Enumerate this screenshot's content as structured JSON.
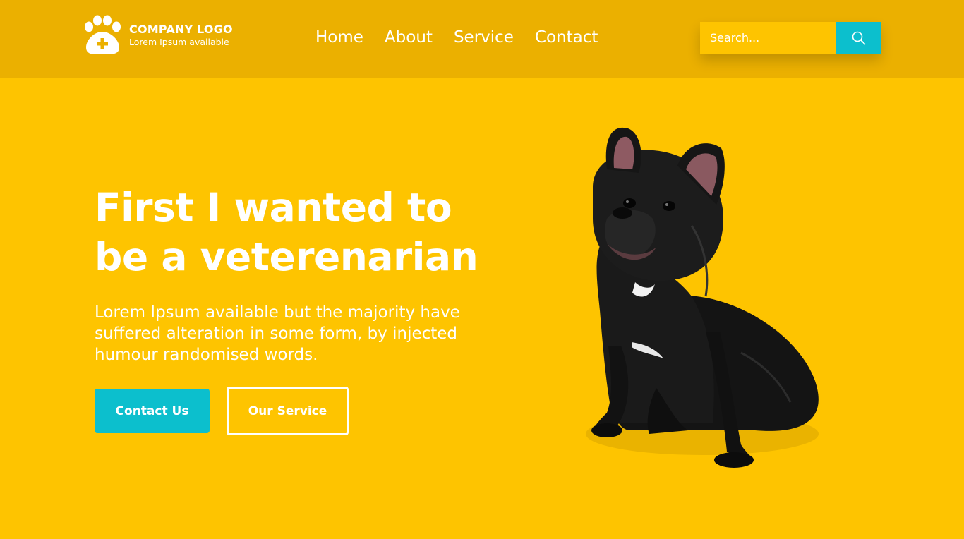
{
  "brand": {
    "title": "COMPANY LOGO",
    "subtitle": "Lorem Ipsum available",
    "logo_icon": "paw-plus-icon"
  },
  "nav": {
    "items": [
      {
        "label": "Home"
      },
      {
        "label": "About"
      },
      {
        "label": "Service"
      },
      {
        "label": "Contact"
      }
    ]
  },
  "search": {
    "placeholder": "Search...",
    "button_icon": "search-icon"
  },
  "hero": {
    "title": "First I wanted to be a veterenarian",
    "text": "Lorem Ipsum available but the majority have suffered alteration in some form, by injected humour randomised words.",
    "primary_button": "Contact Us",
    "secondary_button": "Our Service",
    "image": "black-french-bulldog"
  },
  "colors": {
    "background": "#FEC400",
    "header": "#EBB000",
    "accent": "#0CBFCD",
    "text": "#FFFFFF"
  }
}
